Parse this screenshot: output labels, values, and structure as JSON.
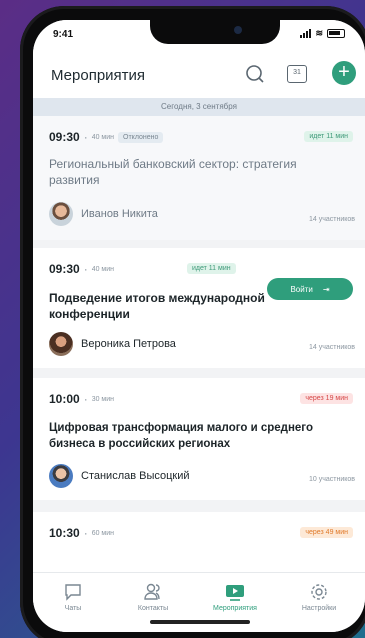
{
  "status": {
    "time": "9:41"
  },
  "header": {
    "title": "Мероприятия",
    "calendar_label": "31",
    "add_label": "+"
  },
  "date_band": "Сегодня, 3 сентября",
  "events": [
    {
      "time": "09:30",
      "duration": "40 мин",
      "state_badge": "Отклонено",
      "right_badge": "идет 11 мин",
      "title": "Региональный банковский сектор: стратегия развития",
      "host": "Иванов Никита",
      "participants": "14 участников"
    },
    {
      "time": "09:30",
      "duration": "40 мин",
      "right_badge": "идет 11 мин",
      "join_label": "Войти",
      "title": "Подведение итогов международной конференции",
      "host": "Вероника Петрова",
      "participants": "14 участников"
    },
    {
      "time": "10:00",
      "duration": "30 мин",
      "right_badge": "через 19 мин",
      "title": "Цифровая трансформация малого и среднего бизнеса в российских регионах",
      "host": "Станислав Высоцкий",
      "participants": "10 участников"
    },
    {
      "time": "10:30",
      "duration": "60 мин",
      "right_badge": "через 49 мин"
    }
  ],
  "tabs": [
    {
      "label": "Чаты",
      "icon": "chat-icon"
    },
    {
      "label": "Контакты",
      "icon": "contacts-icon"
    },
    {
      "label": "Мероприятия",
      "icon": "events-icon"
    },
    {
      "label": "Настройки",
      "icon": "settings-icon"
    }
  ],
  "colors": {
    "accent": "#2f9e7c",
    "alert": "#d64848",
    "warning": "#e07a2a"
  }
}
